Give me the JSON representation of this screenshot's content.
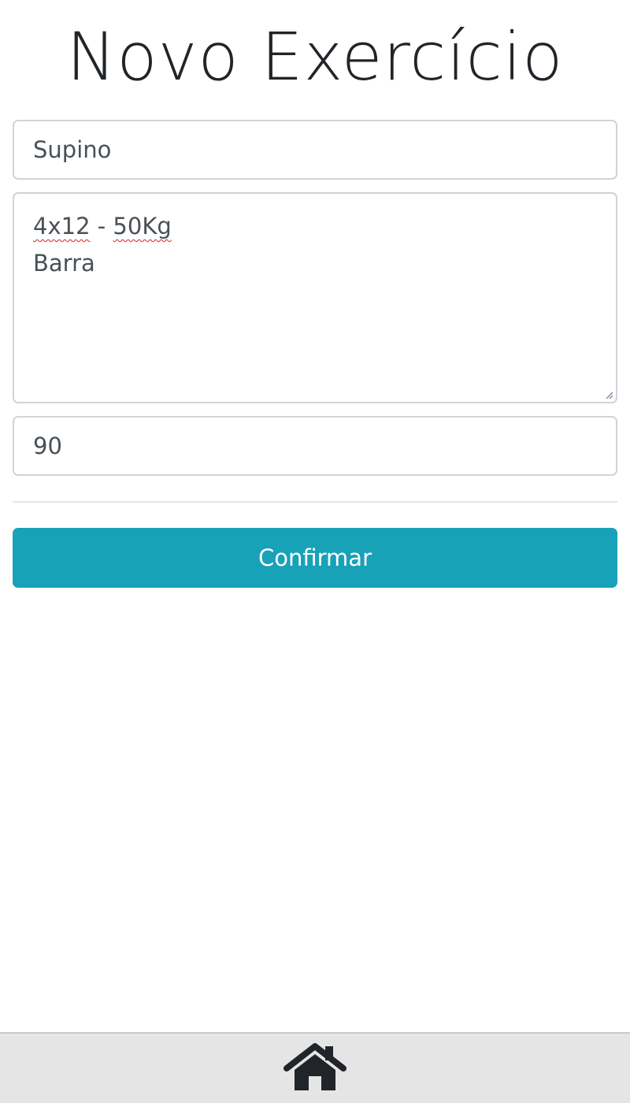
{
  "page": {
    "title": "Novo Exercício"
  },
  "form": {
    "name_value": "Supino",
    "description_lines": [
      "4x12 - 50Kg",
      "Barra"
    ],
    "description_words_flagged": [
      "4x12",
      "50Kg"
    ],
    "rest_value": "90",
    "confirm_label": "Confirmar"
  },
  "footer": {
    "home_icon": "home-icon"
  },
  "colors": {
    "accent": "#17a2b8",
    "footer_bg": "#e5e5e5",
    "text": "#212529"
  }
}
